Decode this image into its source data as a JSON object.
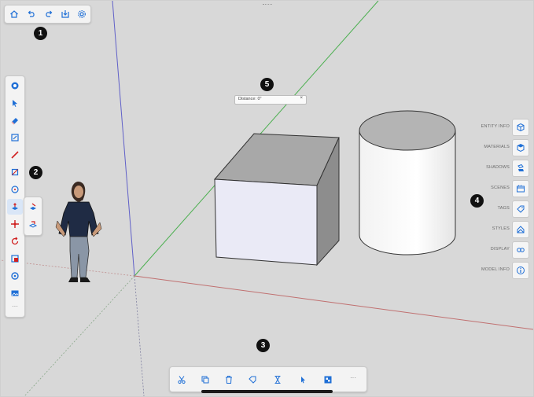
{
  "top_toolbar": {
    "icons": [
      "home-icon",
      "undo-icon",
      "redo-icon",
      "export-icon",
      "settings-icon"
    ]
  },
  "callouts": {
    "c1": "1",
    "c2": "2",
    "c3": "3",
    "c4": "4",
    "c5": "5"
  },
  "measurement_box": {
    "label": "Distance: 0\"",
    "close": "×"
  },
  "right_panel": {
    "items": [
      {
        "label": "ENTITY INFO",
        "icon": "entity-info-icon"
      },
      {
        "label": "MATERIALS",
        "icon": "materials-icon"
      },
      {
        "label": "SHADOWS",
        "icon": "shadows-icon"
      },
      {
        "label": "SCENES",
        "icon": "scenes-icon"
      },
      {
        "label": "TAGS",
        "icon": "tags-icon"
      },
      {
        "label": "STYLES",
        "icon": "styles-icon"
      },
      {
        "label": "DISPLAY",
        "icon": "display-icon"
      },
      {
        "label": "MODEL INFO",
        "icon": "model-info-icon"
      }
    ]
  },
  "left_toolbar": {
    "tools": [
      "orbit-icon",
      "select-icon",
      "eraser-icon",
      "paint-icon",
      "line-icon",
      "rectangle-icon",
      "circle-icon",
      "push-pull-icon",
      "move-icon",
      "rotate-icon",
      "scale-icon",
      "tape-measure-icon",
      "image-icon"
    ],
    "more_label": "···",
    "flyout": [
      "push-pull-variant-icon",
      "follow-me-icon"
    ]
  },
  "bottom_toolbar": {
    "tools": [
      "cut-icon",
      "copy-icon",
      "delete-icon",
      "tag-icon",
      "hourglass-icon",
      "select-arrow-icon",
      "checker-icon"
    ],
    "more_label": "···"
  },
  "colors": {
    "canvas": "#d8d8d8",
    "accent": "#1f6fd6",
    "axis_red": "#c07070",
    "axis_green": "#4caf50",
    "axis_blue": "#6060c8"
  }
}
